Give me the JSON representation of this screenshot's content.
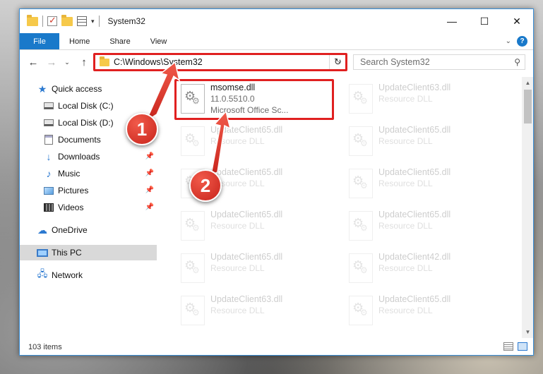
{
  "window": {
    "title": "System32",
    "controls": {
      "minimize": "—",
      "maximize": "☐",
      "close": "✕"
    }
  },
  "ribbon": {
    "tabs": [
      "File",
      "Home",
      "Share",
      "View"
    ],
    "help": "?"
  },
  "navigation": {
    "back": "←",
    "forward": "→",
    "recent": "⌄",
    "up": "↑"
  },
  "address": {
    "path": "C:\\Windows\\System32",
    "dropdown": "⌄",
    "refresh": "↻"
  },
  "search": {
    "placeholder": "Search System32",
    "icon": "search-icon"
  },
  "sidebar": {
    "items": [
      {
        "label": "Quick access",
        "icon": "star-icon",
        "pinned": false
      },
      {
        "label": "Local Disk (C:)",
        "icon": "drive-icon",
        "pinned": false
      },
      {
        "label": "Local Disk (D:)",
        "icon": "drive-icon",
        "pinned": false
      },
      {
        "label": "Documents",
        "icon": "documents-icon",
        "pinned": true
      },
      {
        "label": "Downloads",
        "icon": "downloads-icon",
        "pinned": true
      },
      {
        "label": "Music",
        "icon": "music-icon",
        "pinned": true
      },
      {
        "label": "Pictures",
        "icon": "pictures-icon",
        "pinned": true
      },
      {
        "label": "Videos",
        "icon": "videos-icon",
        "pinned": true
      },
      {
        "label": "OneDrive",
        "icon": "cloud-icon",
        "pinned": false
      },
      {
        "label": "This PC",
        "icon": "computer-icon",
        "pinned": false,
        "selected": true
      },
      {
        "label": "Network",
        "icon": "network-icon",
        "pinned": false
      }
    ]
  },
  "files": {
    "highlighted": {
      "name": "msomse.dll",
      "version": "11.0.5510.0",
      "description": "Microsoft Office Sc..."
    },
    "faded": [
      {
        "name": "UpdateClient63.dll",
        "type": "Resource DLL"
      },
      {
        "name": "UpdateClient65.dll",
        "type": "Resource DLL"
      },
      {
        "name": "UpdateClient65.dll",
        "type": "Resource DLL"
      },
      {
        "name": "UpdateClient65.dll",
        "type": "Resource DLL"
      },
      {
        "name": "UpdateClient65.dll",
        "type": "Resource DLL"
      },
      {
        "name": "UpdateClient65.dll",
        "type": "Resource DLL"
      },
      {
        "name": "UpdateClient65.dll",
        "type": "Resource DLL"
      },
      {
        "name": "UpdateClient65.dll",
        "type": "Resource DLL"
      },
      {
        "name": "UpdateClient42.dll",
        "type": "Resource DLL"
      },
      {
        "name": "UpdateClient63.dll",
        "type": "Resource DLL"
      },
      {
        "name": "UpdateClient65.dll",
        "type": "Resource DLL"
      }
    ]
  },
  "status": {
    "item_count": "103 items"
  },
  "callouts": {
    "one": "1",
    "two": "2"
  },
  "colors": {
    "accent": "#1979ca",
    "highlight": "#e02020",
    "selected": "#d9d9d9"
  }
}
